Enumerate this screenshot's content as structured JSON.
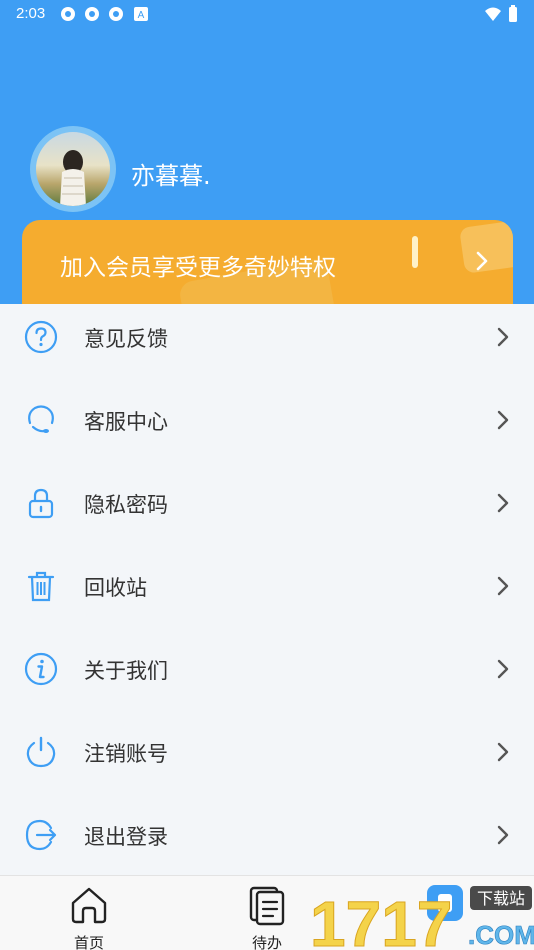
{
  "status_bar": {
    "time": "2:03"
  },
  "profile": {
    "username": "亦暮暮."
  },
  "vip_banner": {
    "label": "加入会员享受更多奇妙特权"
  },
  "menu": [
    {
      "label": "意见反馈",
      "icon": "help-circle-icon"
    },
    {
      "label": "客服中心",
      "icon": "customer-service-icon"
    },
    {
      "label": "隐私密码",
      "icon": "lock-icon"
    },
    {
      "label": "回收站",
      "icon": "trash-icon"
    },
    {
      "label": "关于我们",
      "icon": "info-icon"
    },
    {
      "label": "注销账号",
      "icon": "power-icon"
    },
    {
      "label": "退出登录",
      "icon": "logout-icon"
    }
  ],
  "tabbar": {
    "home": "首页",
    "todo": "待办"
  },
  "watermark": {
    "text_a": "1717",
    "text_b": "下载站",
    "text_c": ".COM"
  },
  "colors": {
    "primary": "#3e9ef4",
    "vip": "#f5ac2f",
    "icon": "#3e9ef4"
  }
}
